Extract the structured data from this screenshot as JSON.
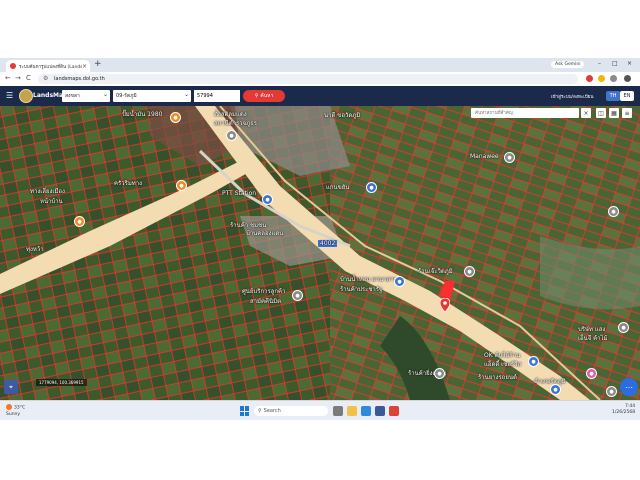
{
  "browser": {
    "tab_title": "ระบบค้นหารูปแปลงที่ดิน (LandsMaps)",
    "tab_close": "×",
    "new_tab": "+",
    "ask_gemini": "Ask Gemini",
    "win_min": "–",
    "win_max": "□",
    "win_close": "×",
    "url": "landsmaps.dol.go.th",
    "back": "←",
    "forward": "→",
    "reload": "C"
  },
  "app": {
    "brand": "LandsMaps",
    "menu_icon": "☰",
    "province_select": "สงขลา",
    "district_select": "09-รัตภูมิ",
    "parcel_number": "57994",
    "search_button": "ค้นหา",
    "search_icon": "⚲",
    "login": "เข้าสู่ระบบ/ลงทะเบียน",
    "lang_th": "TH",
    "lang_en": "EN"
  },
  "map": {
    "search_placeholder": "ค้นหาสถานที่สำคัญ",
    "search_close": "×",
    "coords": "1779094, 100.369915",
    "compass": "⌖",
    "fab_icon": "⋯",
    "labels": {
      "l1": "ปั๊มน้ำมัน 1980",
      "l2": "ตั้งสติลมแดง",
      "l3": "สถานีตำรวจภูธร",
      "l4": "นาดี ขอวัดภูมิ",
      "l5": "Manawee",
      "l6": "ครัวริมทาง",
      "l7": "PTT Station",
      "l8": "แกนขยัน",
      "l9": "ทางเลี่ยงเมือง",
      "l10": "ร้านค้า ชุมชน",
      "l11": "หน้าบ้าน",
      "l12": "ทุ่งหว้า",
      "l13": "บ้านคลองแดน",
      "l14": "ร้านเจ๊ะวิดภูมิ",
      "l15": "บ้านน้ำหอม ผานาสาร",
      "l16": "ศูนย์บริการลูกค้า",
      "l17": "สามัคคีนิมิต",
      "l18": "ร้านค้าประชารัฐ",
      "l19": "OK ต้นไม้ร้าน",
      "l20": "แอ็ดดี้ เซอร์วิส",
      "l21": "บริษัท แสง",
      "l22": "เอ็นจี ค้าไม้",
      "l23": "ร้านค้ายิ่งเจริญ",
      "l24": "ร้านยางรถยนต์",
      "l25": "อำเภอรัตภูมิ",
      "l26": "4002"
    }
  },
  "taskbar": {
    "weather_temp": "33°C",
    "weather_desc": "Sunny",
    "search_placeholder": "Search",
    "time": "7:44",
    "date": "1/26/2568"
  },
  "colors": {
    "app_header": "#1b2a4a",
    "accent_red": "#e53935",
    "parcel_line": "#ff2d2d",
    "road": "#f3dcb2",
    "lang_active": "#3f74c9"
  },
  "icons": [
    "menu-icon",
    "search-icon",
    "close-icon",
    "location-pin-icon",
    "fuel-icon",
    "school-icon",
    "shop-icon",
    "layers-icon",
    "grid-icon",
    "compass-icon",
    "windows-start-icon"
  ]
}
